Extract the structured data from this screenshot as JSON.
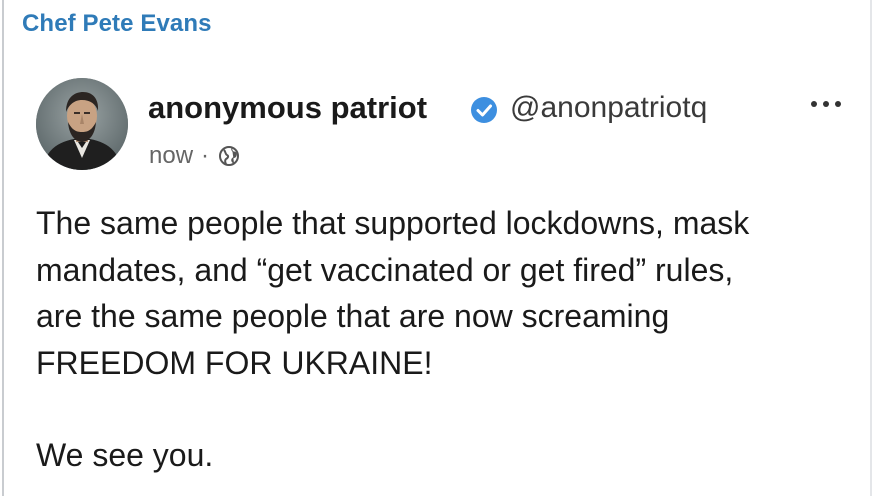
{
  "channel": {
    "name": "Chef Pete Evans",
    "accent_color": "#2f7bb8"
  },
  "post": {
    "author": {
      "display_name": "anonymous patriot",
      "verified_icon": "verified-badge-icon",
      "verified_color": "#3d8fe0",
      "handle": "@anonpatriotq",
      "avatar": "avatar-portrait"
    },
    "meta": {
      "time": "now",
      "separator": "·",
      "visibility_icon": "globe-icon"
    },
    "more_icon": "more-options-icon",
    "body_lines": [
      "The same people that supported lockdowns, mask",
      "mandates, and “get vaccinated or get fired” rules,",
      "are the same people that are now screaming",
      "FREEDOM FOR UKRAINE!"
    ],
    "closing_line": "We see you."
  }
}
